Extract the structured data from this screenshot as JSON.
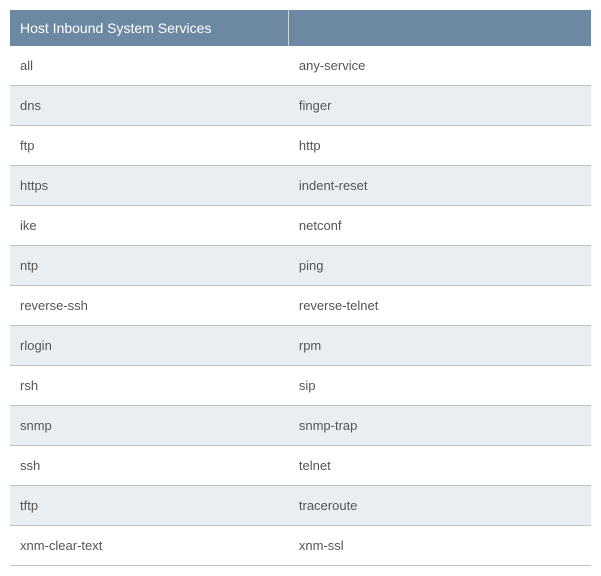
{
  "header": {
    "col1": "Host Inbound System Services",
    "col2": ""
  },
  "rows": [
    {
      "c1": "all",
      "c2": "any-service"
    },
    {
      "c1": "dns",
      "c2": "finger"
    },
    {
      "c1": "ftp",
      "c2": "http"
    },
    {
      "c1": "https",
      "c2": "indent-reset"
    },
    {
      "c1": "ike",
      "c2": "netconf"
    },
    {
      "c1": "ntp",
      "c2": "ping"
    },
    {
      "c1": "reverse-ssh",
      "c2": "reverse-telnet"
    },
    {
      "c1": "rlogin",
      "c2": "rpm"
    },
    {
      "c1": "rsh",
      "c2": "sip"
    },
    {
      "c1": "snmp",
      "c2": "snmp-trap"
    },
    {
      "c1": "ssh",
      "c2": "telnet"
    },
    {
      "c1": "tftp",
      "c2": "traceroute"
    },
    {
      "c1": "xnm-clear-text",
      "c2": "xnm-ssl"
    }
  ]
}
